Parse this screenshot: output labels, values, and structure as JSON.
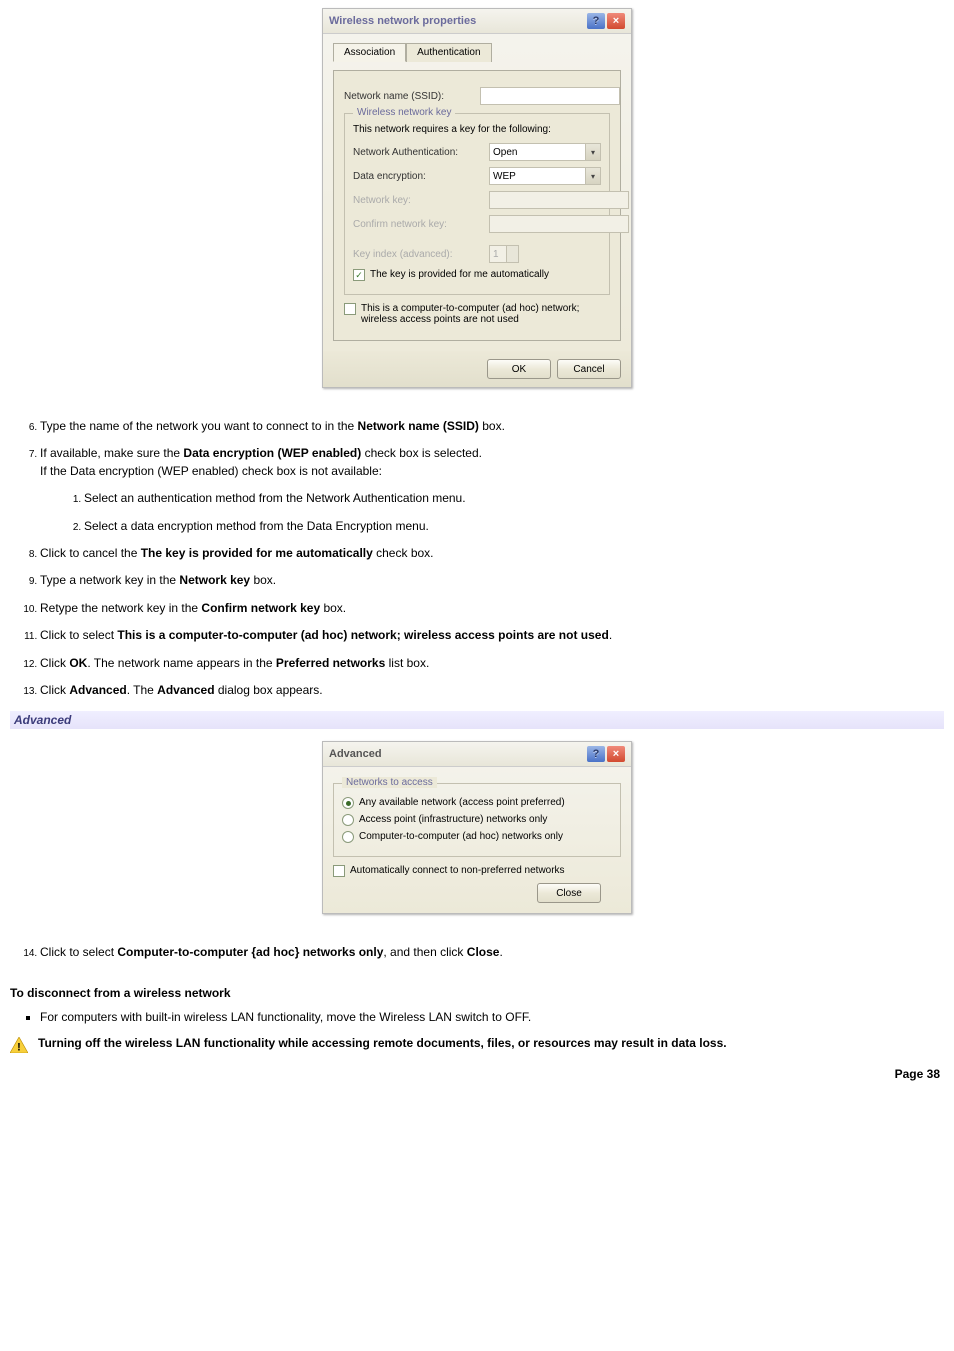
{
  "dialog1": {
    "title": "Wireless network properties",
    "tabs": [
      "Association",
      "Authentication"
    ],
    "ssid_label": "Network name (SSID):",
    "ssid_value": "",
    "group_title": "Wireless network key",
    "req_text": "This network requires a key for the following:",
    "auth_label": "Network Authentication:",
    "auth_value": "Open",
    "enc_label": "Data encryption:",
    "enc_value": "WEP",
    "key_label": "Network key:",
    "confirm_label": "Confirm network key:",
    "index_label": "Key index (advanced):",
    "index_value": "1",
    "auto_label": "The key is provided for me automatically",
    "adhoc_label": "This is a computer-to-computer (ad hoc) network; wireless access points are not used",
    "ok": "OK",
    "cancel": "Cancel"
  },
  "steps": {
    "s6": "Type the name of the network you want to connect to in the ",
    "s6b": "Network name (SSID)",
    "s6c": " box.",
    "s7a": "If available, make sure the ",
    "s7b": "Data encryption (WEP enabled)",
    "s7c": " check box is selected.",
    "s7d": "If the Data encryption (WEP enabled) check box is not available:",
    "s7_1": "Select an authentication method from the Network Authentication menu.",
    "s7_2": "Select a data encryption method from the Data Encryption menu.",
    "s8a": "Click to cancel the ",
    "s8b": "The key is provided for me automatically",
    "s8c": " check box.",
    "s9a": "Type a network key in the ",
    "s9b": "Network key",
    "s9c": " box.",
    "s10a": "Retype the network key in the ",
    "s10b": "Confirm network key",
    "s10c": " box.",
    "s11a": "Click to select ",
    "s11b": "This is a computer-to-computer (ad hoc) network; wireless access points are not used",
    "s11c": ".",
    "s12a": "Click ",
    "s12b": "OK",
    "s12c": ". The network name appears in the ",
    "s12d": "Preferred networks",
    "s12e": " list box.",
    "s13a": "Click ",
    "s13b": "Advanced",
    "s13c": ". The ",
    "s13d": "Advanced",
    "s13e": " dialog box appears.",
    "s14a": "Click to select ",
    "s14b": "Computer-to-computer {ad hoc} networks only",
    "s14c": ", and then click ",
    "s14d": "Close",
    "s14e": "."
  },
  "advanced_heading": "Advanced",
  "dialog2": {
    "title": "Advanced",
    "group_title": "Networks to access",
    "opt1": "Any available network (access point preferred)",
    "opt2": "Access point (infrastructure) networks only",
    "opt3": "Computer-to-computer (ad hoc) networks only",
    "auto_connect": "Automatically connect to non-preferred networks",
    "close": "Close"
  },
  "disconnect_head": "To disconnect from a wireless network",
  "disconnect_item": "For computers with built-in wireless LAN functionality, move the Wireless LAN switch to OFF.",
  "warning": "Turning off the wireless LAN functionality while accessing remote documents, files, or resources may result in data loss.",
  "page": "Page 38"
}
